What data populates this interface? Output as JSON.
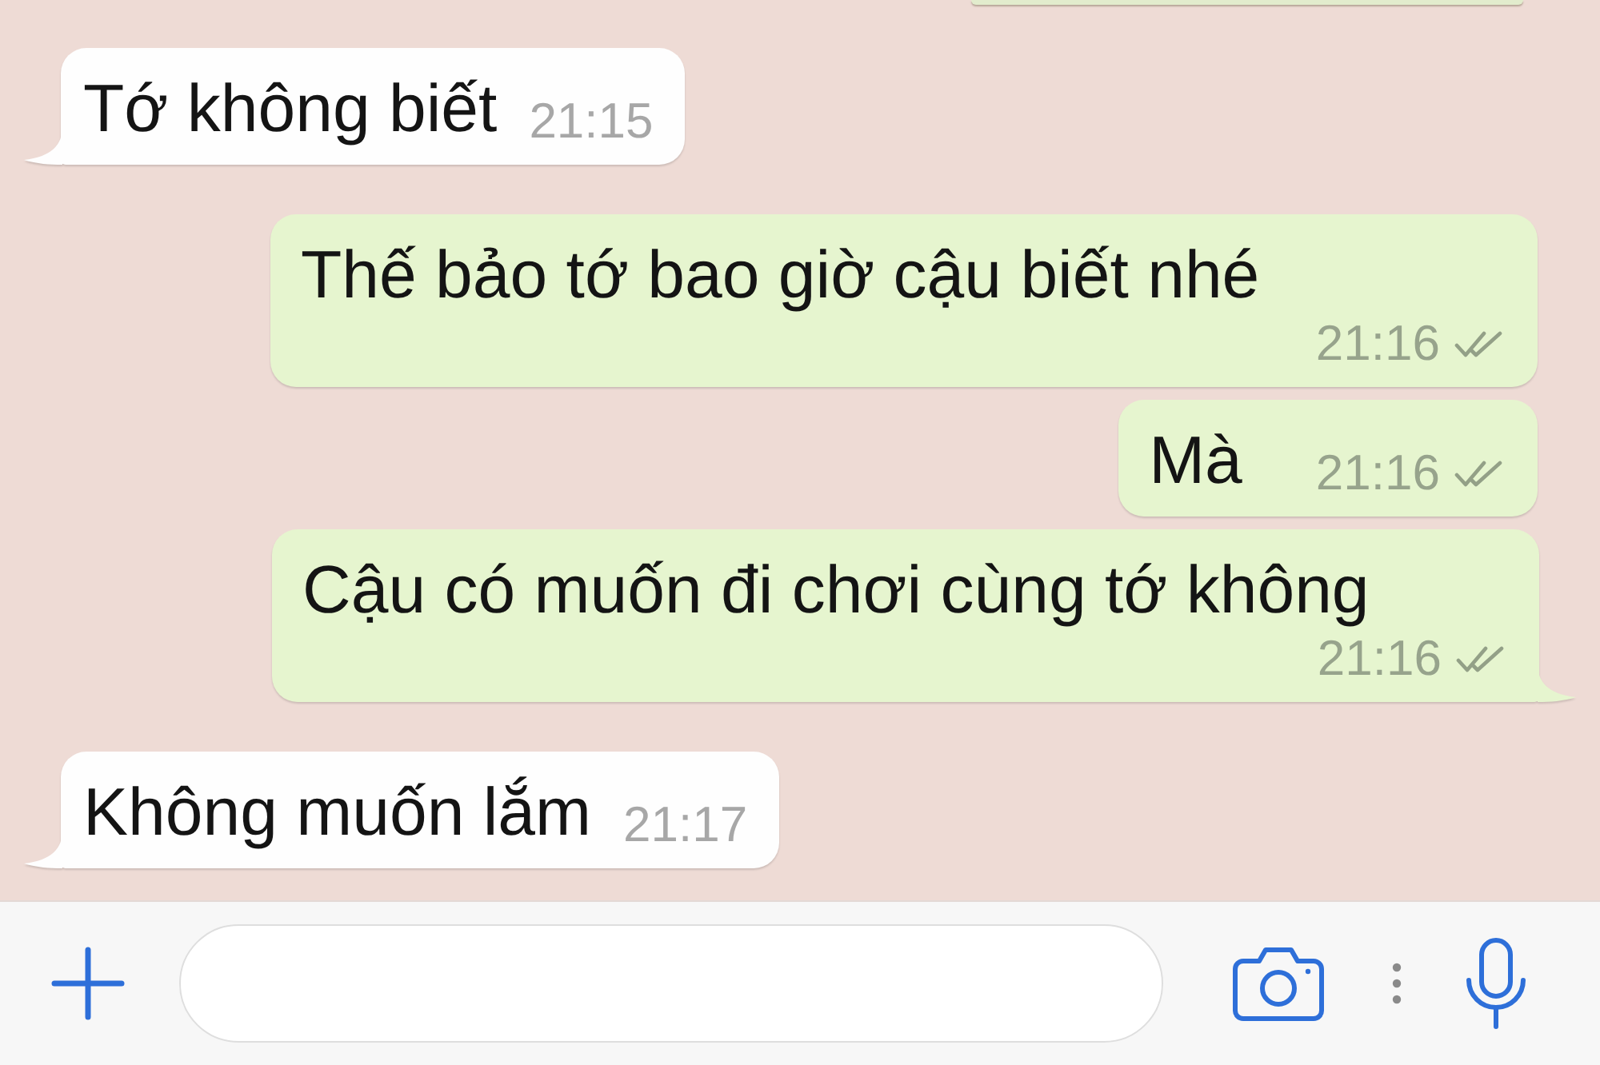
{
  "messages": [
    {
      "kind": "incoming",
      "text": "Tớ không biết",
      "time": "21:15"
    },
    {
      "kind": "outgoing",
      "text": "Thế bảo tớ bao giờ cậu biết nhé",
      "time": "21:16",
      "read": false
    },
    {
      "kind": "outgoing",
      "text": "Mà",
      "time": "21:16",
      "read": false
    },
    {
      "kind": "outgoing",
      "text": "Cậu có muốn đi chơi cùng tớ không",
      "time": "21:16",
      "read": false
    },
    {
      "kind": "incoming",
      "text": "Không muốn lắm",
      "time": "21:17"
    }
  ]
}
